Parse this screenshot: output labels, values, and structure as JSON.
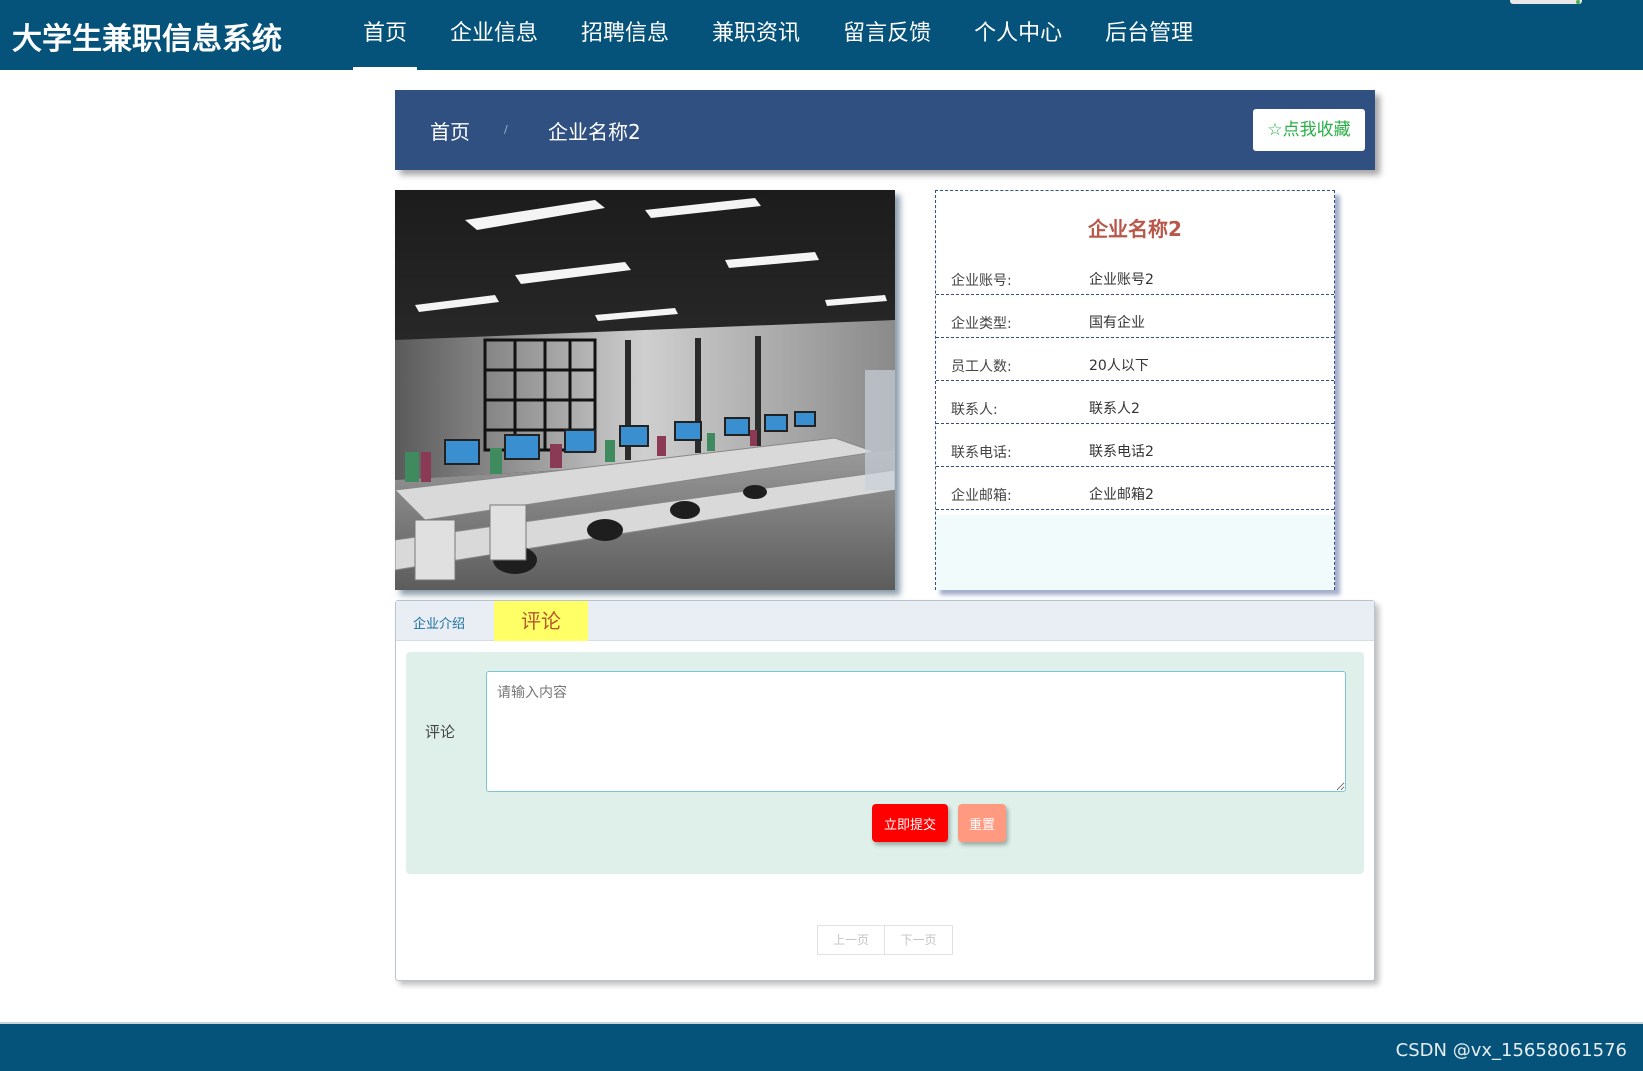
{
  "header": {
    "site_title": "大学生兼职信息系统",
    "nav": [
      {
        "label": "首页",
        "active": true
      },
      {
        "label": "企业信息",
        "active": false
      },
      {
        "label": "招聘信息",
        "active": false
      },
      {
        "label": "兼职资讯",
        "active": false
      },
      {
        "label": "留言反馈",
        "active": false
      },
      {
        "label": "个人中心",
        "active": false
      },
      {
        "label": "后台管理",
        "active": false
      }
    ]
  },
  "breadcrumb": {
    "home": "首页",
    "separator": "/",
    "current": "企业名称2"
  },
  "favorite_button": {
    "icon": "star-outline-icon",
    "label": "点我收藏"
  },
  "company": {
    "name": "企业名称2",
    "fields": [
      {
        "label": "企业账号:",
        "value": "企业账号2"
      },
      {
        "label": "企业类型:",
        "value": "国有企业"
      },
      {
        "label": "员工人数:",
        "value": "20人以下"
      },
      {
        "label": "联系人:",
        "value": "联系人2"
      },
      {
        "label": "联系电话:",
        "value": "联系电话2"
      },
      {
        "label": "企业邮箱:",
        "value": "企业邮箱2"
      }
    ]
  },
  "tabs": {
    "intro": "企业介绍",
    "comment": "评论"
  },
  "comment_form": {
    "label": "评论",
    "placeholder": "请输入内容",
    "submit": "立即提交",
    "reset": "重置"
  },
  "pager": {
    "prev": "上一页",
    "next": "下一页"
  },
  "footer": {
    "watermark": "CSDN @vx_15658061576"
  },
  "colors": {
    "header_bg": "#05527a",
    "breadcrumb_bg": "#2f5080",
    "company_title": "#b8574a",
    "submit_bg": "#ff0000",
    "reset_bg": "#ff9980",
    "comment_tab_bg": "#ffff66"
  }
}
